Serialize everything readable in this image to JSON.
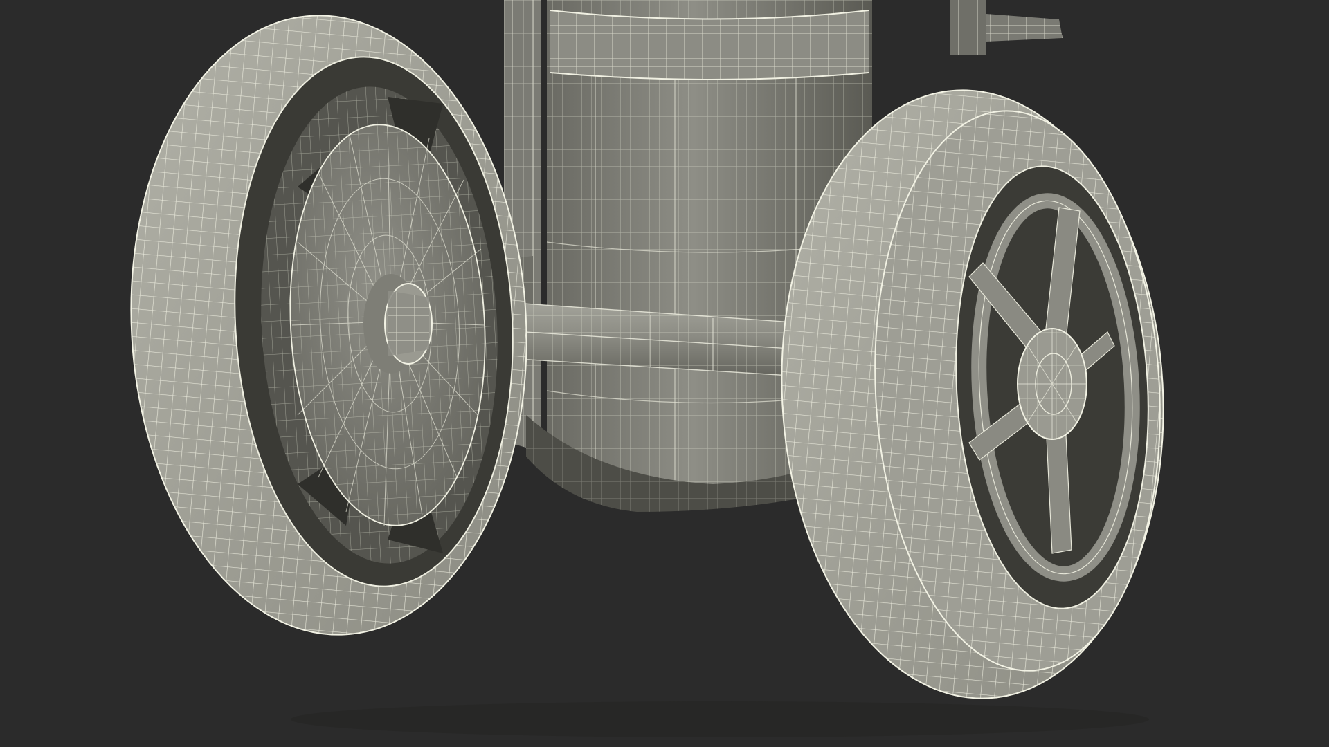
{
  "scene": {
    "subject": "wireframe-render-wheeled-cylinder-cart",
    "colors": {
      "background": "#2b2b2b",
      "surface_light": "#a4a49b",
      "surface_mid": "#8d8d84",
      "surface_dark": "#5d5d56",
      "shadow": "#3c3c37",
      "wire": "#eeeee0",
      "wire_faint": "#c9c9bc"
    }
  }
}
